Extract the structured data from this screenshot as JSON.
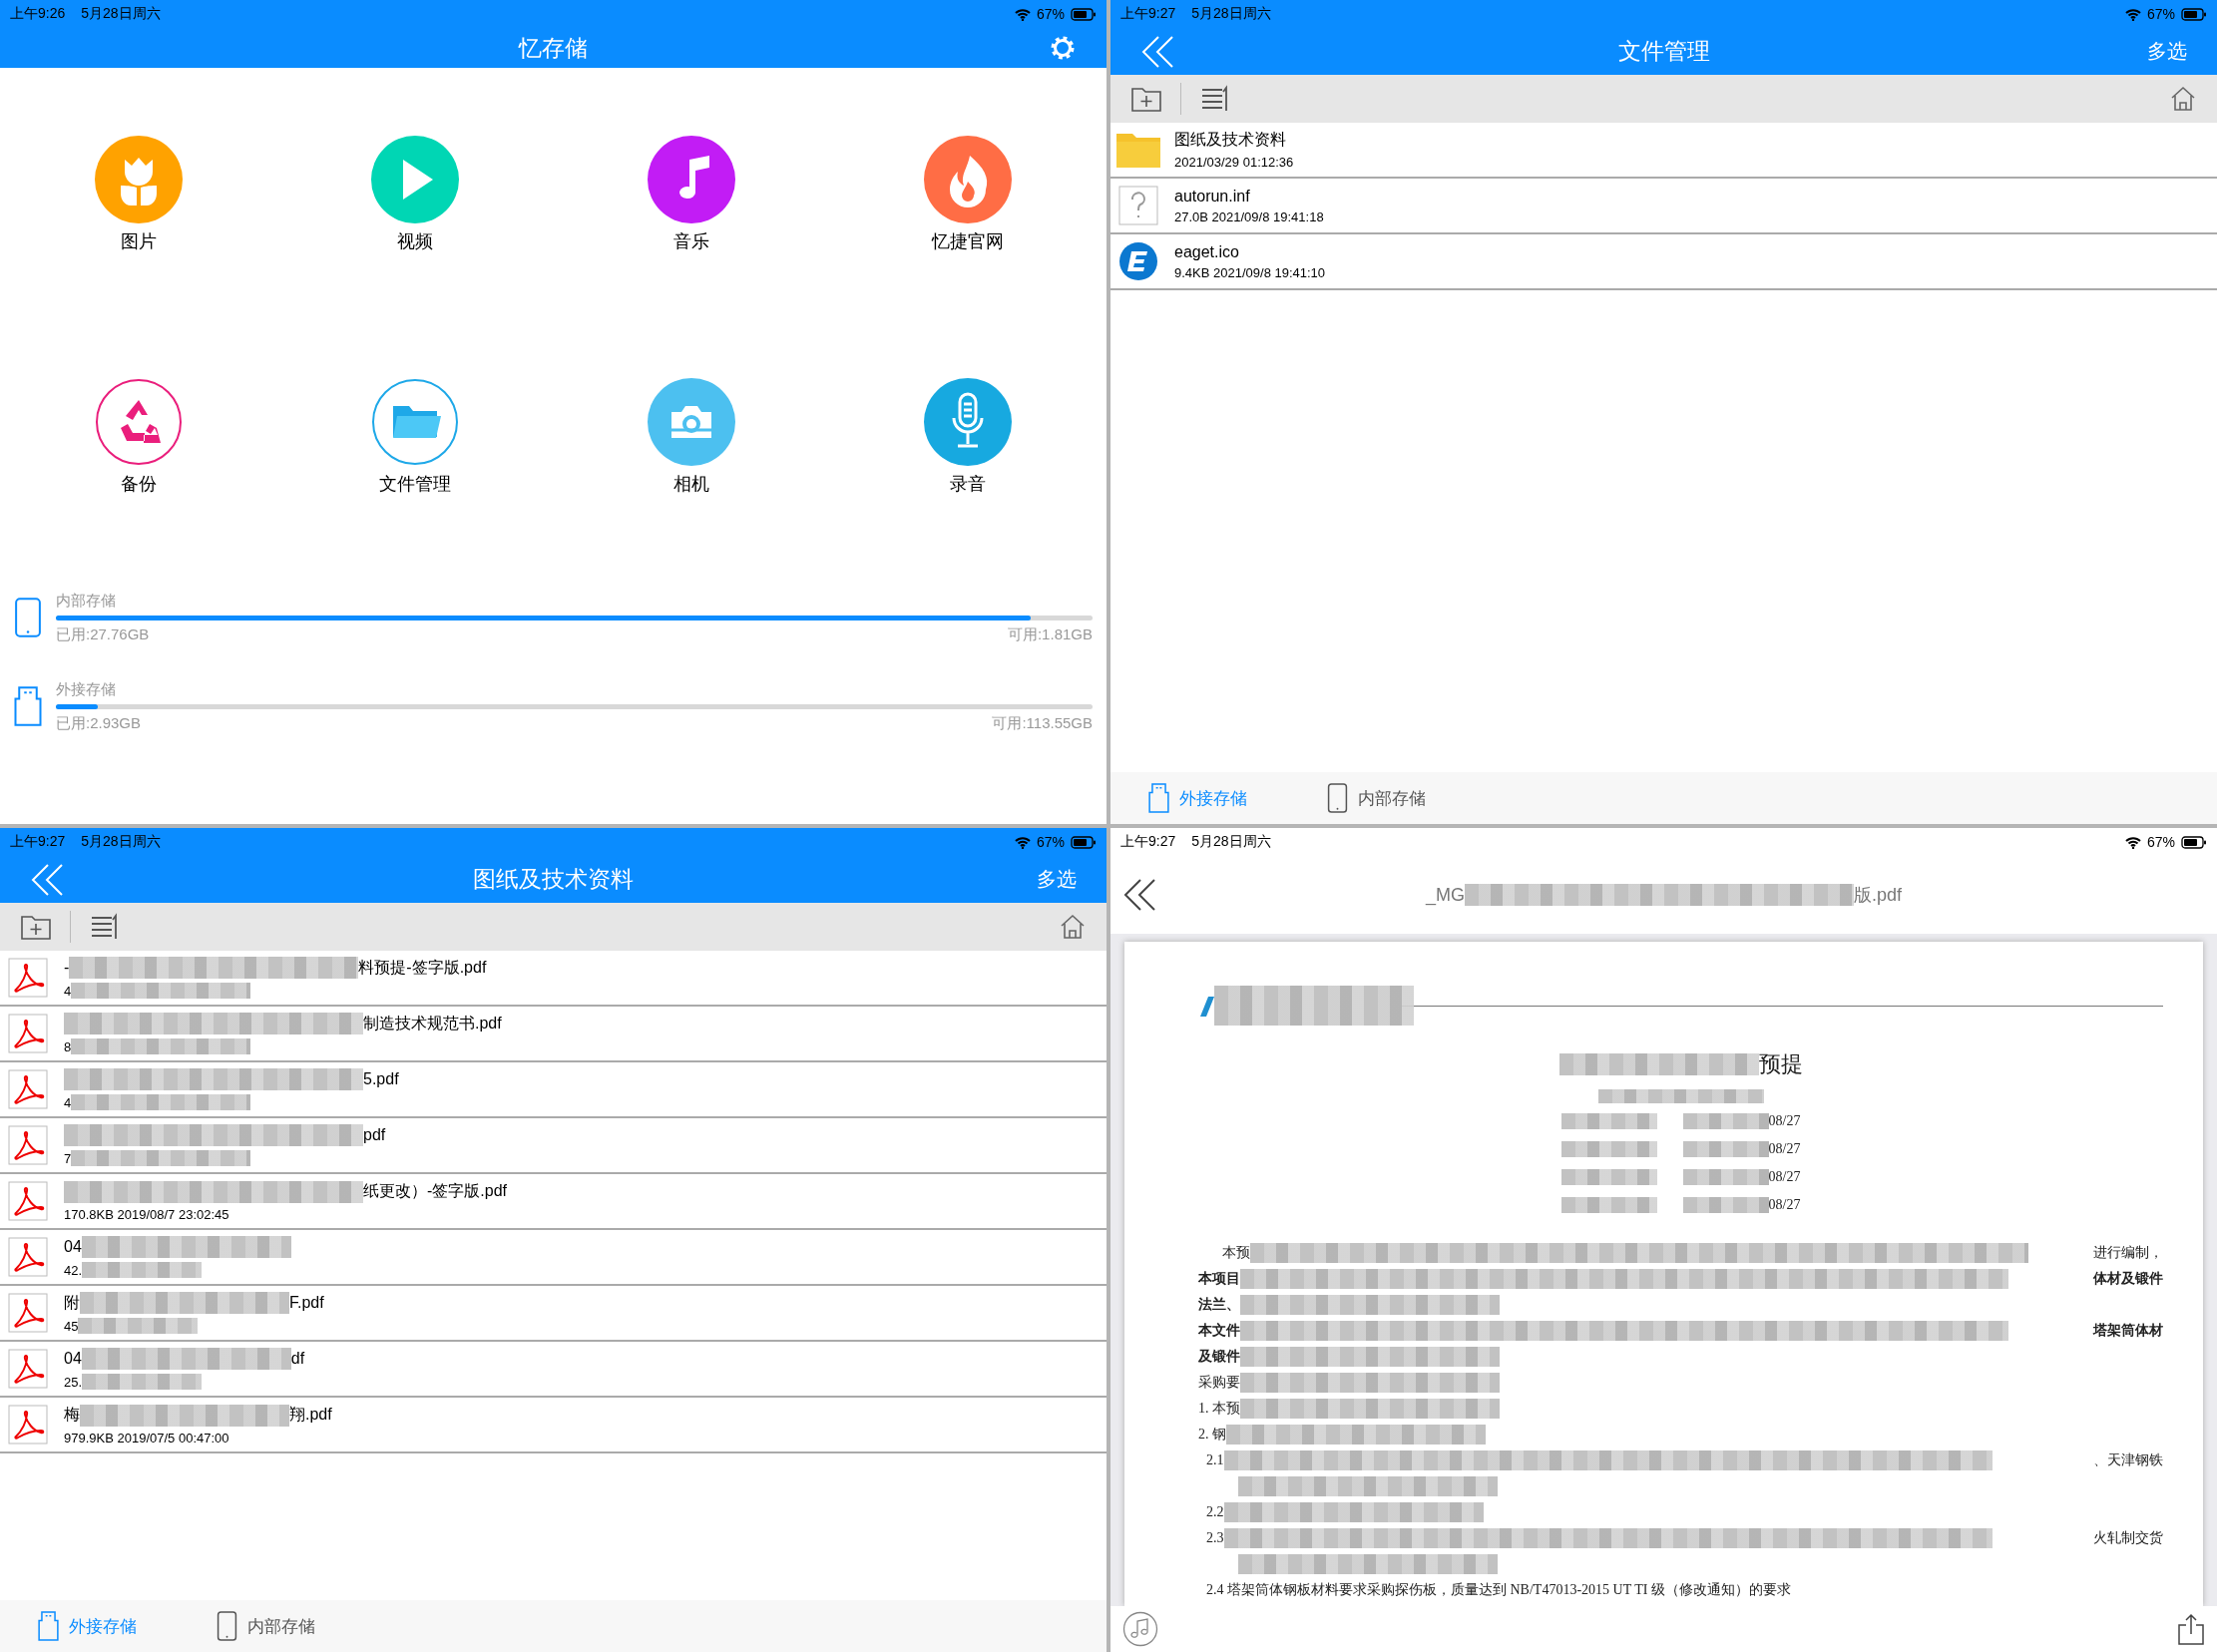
{
  "home_screen": {
    "status_bar": {
      "time": "上午9:26",
      "date": "5月28日周六",
      "battery": "67%"
    },
    "title": "忆存储",
    "apps": [
      {
        "kind": "photos",
        "label": "图片"
      },
      {
        "kind": "video",
        "label": "视频"
      },
      {
        "kind": "music",
        "label": "音乐"
      },
      {
        "kind": "website",
        "label": "忆捷官网"
      },
      {
        "kind": "backup",
        "label": "备份"
      },
      {
        "kind": "files",
        "label": "文件管理"
      },
      {
        "kind": "camera",
        "label": "相机"
      },
      {
        "kind": "recorder",
        "label": "录音"
      }
    ],
    "storage": [
      {
        "kind": "phone",
        "label": "内部存储",
        "level": 0.94,
        "used": "已用:27.76GB",
        "available": "可用:1.81GB"
      },
      {
        "kind": "usb",
        "label": "外接存储",
        "level": 0.04,
        "used": "已用:2.93GB",
        "available": "可用:113.55GB"
      }
    ]
  },
  "file_manager": {
    "status_bar": {
      "time": "上午9:27",
      "date": "5月28日周六",
      "battery": "67%"
    },
    "title": "文件管理",
    "multi_select": "多选",
    "files": [
      {
        "kind": "folder",
        "name": "图纸及技术资料",
        "meta": "2021/03/29 01:12:36"
      },
      {
        "kind": "unknown",
        "name": "autorun.inf",
        "meta": "27.0B  2021/09/8 19:41:18"
      },
      {
        "kind": "app",
        "name": "eaget.ico",
        "meta": "9.4KB  2021/09/8 19:41:10"
      }
    ],
    "tabs": [
      {
        "kind": "usb",
        "label": "外接存储",
        "selected": true
      },
      {
        "kind": "phone",
        "label": "内部存储",
        "selected": false
      }
    ]
  },
  "folder_view": {
    "status_bar": {
      "time": "上午9:27",
      "date": "5月28日周六",
      "battery": "67%"
    },
    "title": "图纸及技术资料",
    "multi_select": "多选",
    "files": [
      {
        "name_start": "-",
        "name_end": "料预提-签字版.pdf",
        "meta": "4",
        "meta_blurred": true
      },
      {
        "name_end": "制造技术规范书.pdf",
        "meta": "8",
        "meta_blurred": true
      },
      {
        "name_end": "5.pdf",
        "meta": "4",
        "meta_blurred": true
      },
      {
        "name_end": "pdf",
        "meta": "7",
        "meta_blurred": true
      },
      {
        "name_end": "纸更改）-签字版.pdf",
        "meta": "170.8KB  2019/08/7 23:02:45",
        "meta_blurred": false
      },
      {
        "name_start": "04",
        "meta": "42.",
        "meta_blurred": true
      },
      {
        "name_start": "附",
        "name_end": "F.pdf",
        "meta": "45",
        "meta_blurred": true
      },
      {
        "name_start": "04",
        "name_end": "df",
        "meta": "25.",
        "meta_blurred": true
      },
      {
        "name_start": "梅",
        "name_end": "翔.pdf",
        "meta": "979.9KB  2019/07/5 00:47:00",
        "meta_blurred": false
      }
    ],
    "tabs": [
      {
        "kind": "usb",
        "label": "外接存储",
        "selected": true
      },
      {
        "kind": "phone",
        "label": "内部存储",
        "selected": false
      }
    ]
  },
  "pdf_viewer": {
    "status_bar": {
      "time": "上午9:27",
      "date": "5月28日周六",
      "battery": "67%"
    },
    "title_start": "_MG",
    "title_end": "版.pdf",
    "doc_title_end": "预提",
    "dates": [
      "08/27",
      "08/27",
      "08/27",
      "08/27"
    ],
    "lines": [
      {
        "kind": "para",
        "start": "本预",
        "end": "进行编制，",
        "bold": false
      },
      {
        "kind": "plain",
        "start": "本项目",
        "end": "体材及锻件",
        "bold": true
      },
      {
        "kind": "plain",
        "start": "法兰、",
        "bold": true
      },
      {
        "kind": "plain",
        "start": "本文件",
        "end": "塔架筒体材",
        "bold": true
      },
      {
        "kind": "plain",
        "start": "及锻件",
        "bold": true
      },
      {
        "kind": "plain",
        "start": "采购要",
        "bold": false
      },
      {
        "kind": "item",
        "start": "1. 本预",
        "bold": false
      },
      {
        "kind": "item",
        "start": "2. 钢",
        "bold": false
      },
      {
        "kind": "sub",
        "start": "2.1",
        "end": "、天津钢铁",
        "bold": false
      },
      {
        "kind": "cont"
      },
      {
        "kind": "sub",
        "start": "2.2",
        "bold": false
      },
      {
        "kind": "sub",
        "start": "2.3",
        "end": "火轧制交货",
        "bold": false
      },
      {
        "kind": "cont"
      },
      {
        "kind": "sub",
        "start": "2.4 塔架筒体钢板材料要求采购探伤板，质量达到 NB/T47013-2015 UT TI 级（修改通知）的要求",
        "bold": false
      }
    ]
  }
}
